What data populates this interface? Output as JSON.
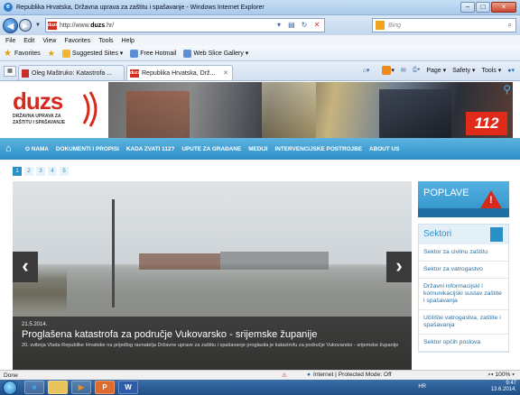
{
  "window": {
    "title": "Republika Hrvatska, Državna uprava za zaštitu i spašavanje - Windows Internet Explorer"
  },
  "address_bar": {
    "url_prefix": "http://www.",
    "url_host": "duzs",
    "url_suffix": ".hr/",
    "search_placeholder": "Bing"
  },
  "menu": [
    "File",
    "Edit",
    "View",
    "Favorites",
    "Tools",
    "Help"
  ],
  "favorites_bar": {
    "favorites_label": "Favorites",
    "items": [
      "Suggested Sites ▾",
      "Free Hotmail",
      "Web Slice Gallery ▾"
    ]
  },
  "tabs": [
    {
      "label": "Oleg Maštruko: Katastrofa ..."
    },
    {
      "label": "Republika Hrvatska, Drž..."
    }
  ],
  "command_bar": [
    "Page ▾",
    "Safety ▾",
    "Tools ▾"
  ],
  "site": {
    "logo_text": "duzs",
    "logo_subtitle_1": "DRŽAVNA UPRAVA ZA",
    "logo_subtitle_2": "ZAŠTITU I SPAŠAVANJE",
    "badge_112": "112",
    "nav": [
      "O NAMA",
      "DOKUMENTI I PROPISI",
      "KADA ZVATI 112?",
      "UPUTE ZA GRAĐANE",
      "MEDIJI",
      "INTERVENCIJSKE POSTROJBE",
      "ABOUT US"
    ],
    "pager": [
      "1",
      "2",
      "3",
      "4",
      "5"
    ],
    "slide": {
      "date": "21.5.2014.",
      "headline": "Proglašena katastrofa za područje Vukovarsko - srijemske županije",
      "text": "20. svibnja Vlada Republike Hrvatske na prijedlog ravnatelja Državne uprave za zaštitu i spašavanje proglasila je katastrofu za područje Vukovarsko - srijemske županije"
    },
    "sidebar": {
      "poplave": "POPLAVE",
      "sektori_title": "Sektori",
      "sektori": [
        "Sektor za civilnu zaštitu",
        "Sektor za vatrogastvo",
        "Državni informacijski i komunikacijski sustav zaštite i spašavanja",
        "Učilište vatrogastva, zaštite i spašavanja",
        "Sektor općih poslova"
      ]
    }
  },
  "status_bar": {
    "left": "Done",
    "zone": "Internet | Protected Mode: Off",
    "zoom": "100%"
  },
  "taskbar": {
    "lang": "HR",
    "time": "9:47",
    "date": "13.6.2014."
  },
  "colors": {
    "brand_red": "#d52b1e",
    "nav_blue": "#2b8fc7"
  }
}
